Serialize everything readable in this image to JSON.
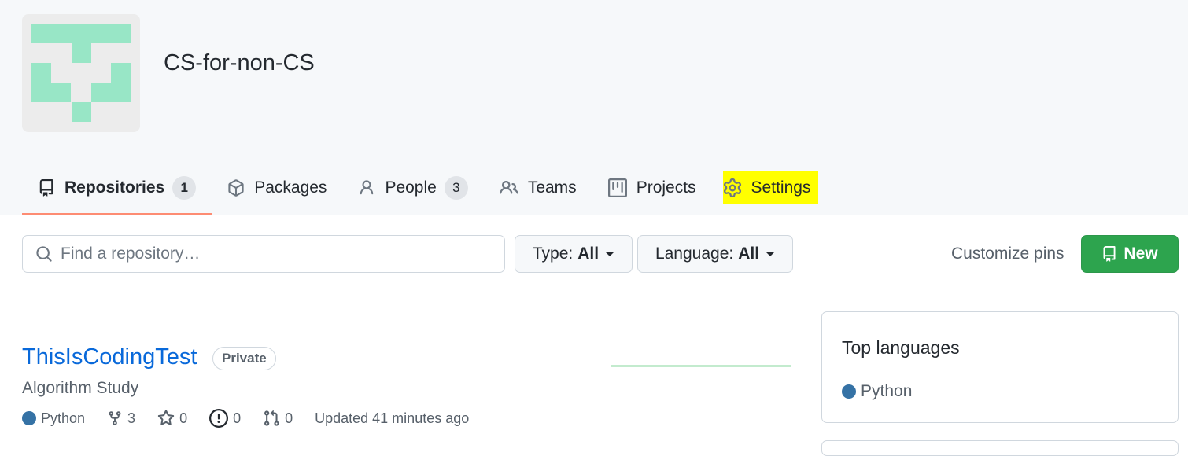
{
  "org": {
    "name": "CS-for-non-CS",
    "avatar_color": "#98e6c6"
  },
  "tabs": [
    {
      "label": "Repositories",
      "icon": "repo-icon",
      "count": "1",
      "selected": true
    },
    {
      "label": "Packages",
      "icon": "package-icon"
    },
    {
      "label": "People",
      "icon": "person-icon",
      "count": "3"
    },
    {
      "label": "Teams",
      "icon": "people-icon"
    },
    {
      "label": "Projects",
      "icon": "project-icon"
    },
    {
      "label": "Settings",
      "icon": "gear-icon",
      "highlighted": true
    }
  ],
  "filters": {
    "search_placeholder": "Find a repository…",
    "type_label": "Type:",
    "type_value": "All",
    "language_label": "Language:",
    "language_value": "All",
    "customize_pins": "Customize pins",
    "new_button": "New"
  },
  "repositories": [
    {
      "name": "ThisIsCodingTest",
      "visibility": "Private",
      "description": "Algorithm Study",
      "language": "Python",
      "language_color": "#3572a5",
      "forks": "3",
      "stars": "0",
      "issues": "0",
      "pull_requests": "0",
      "updated": "Updated 41 minutes ago"
    }
  ],
  "top_languages": {
    "title": "Top languages",
    "items": [
      {
        "name": "Python",
        "color": "#3572a5"
      }
    ]
  },
  "colors": {
    "highlight": "#ffff00",
    "selected_underline": "#fd8c73",
    "new_button": "#2da44e",
    "link": "#0969da"
  }
}
